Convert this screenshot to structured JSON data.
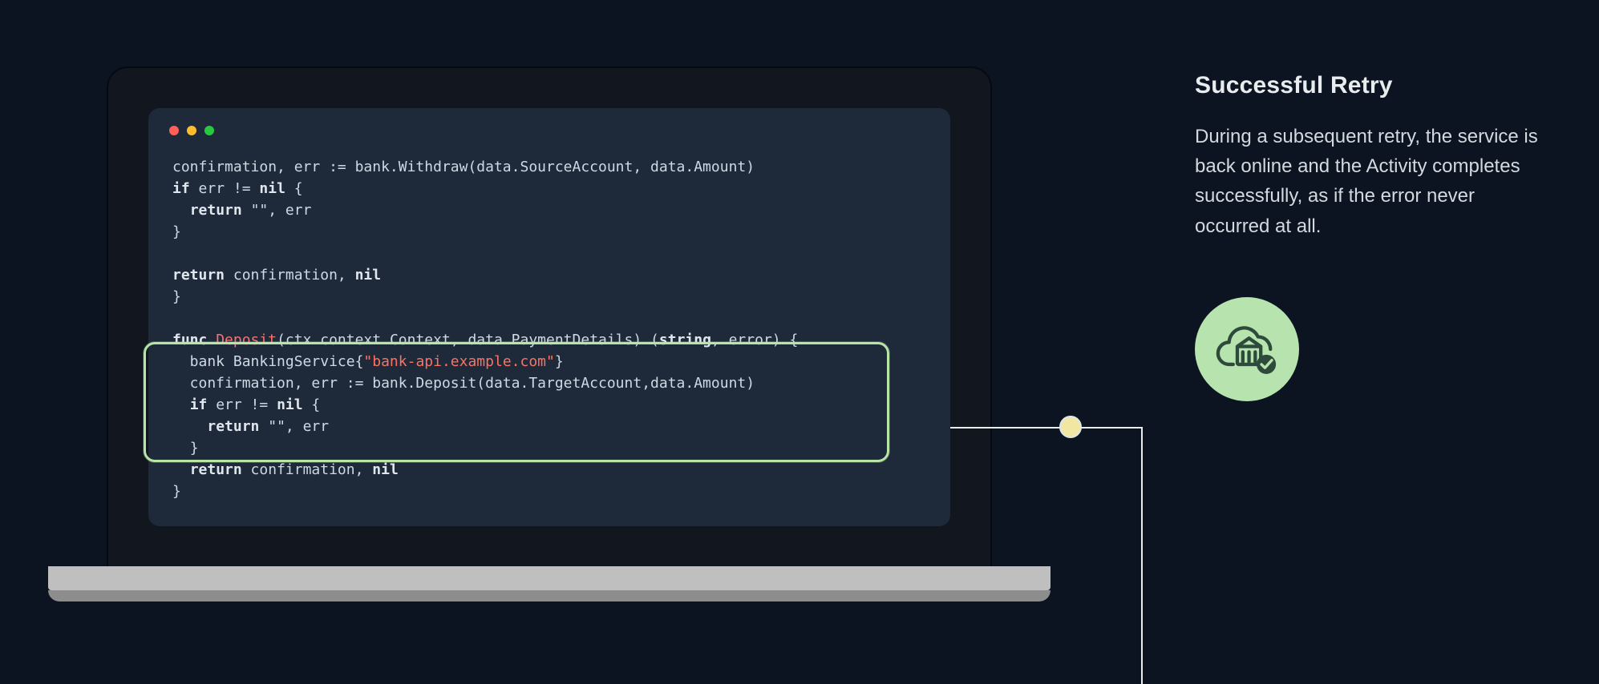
{
  "sidebar": {
    "title": "Successful Retry",
    "body": "During a subsequent retry, the service is back online and the Activity completes successfully, as if the error never occurred at all."
  },
  "code": {
    "pre_lines": [
      "confirmation, err := bank.Withdraw(data.SourceAccount, data.Amount)"
    ],
    "if_kw": "if",
    "nil_kw": "nil",
    "return_kw": "return",
    "quoted_empty": "\"\"",
    "err_token": "err",
    "err_ne_nil_suffix": " err != ",
    "brace_open": " {",
    "brace_close": "}",
    "return_conf_nil": " confirmation, ",
    "func_kw": "func",
    "deposit_name": "Deposit",
    "deposit_sig_rest": "(ctx context.Context, data PaymentDetails) (",
    "string_type": "string",
    "deposit_sig_tail": ", error) {",
    "bank_line_prefix": "  bank BankingService{",
    "bank_url": "\"bank-api.example.com\"",
    "bank_line_suffix": "}",
    "deposit_call": "  confirmation, err := bank.Deposit(data.TargetAccount,data.Amount)",
    "comma_err": ", err"
  },
  "icons": {
    "cloud_success": "cloud-bank-check-icon"
  },
  "colors": {
    "highlight_border": "#b7e5a5",
    "badge_bg": "#b6e3ae"
  }
}
